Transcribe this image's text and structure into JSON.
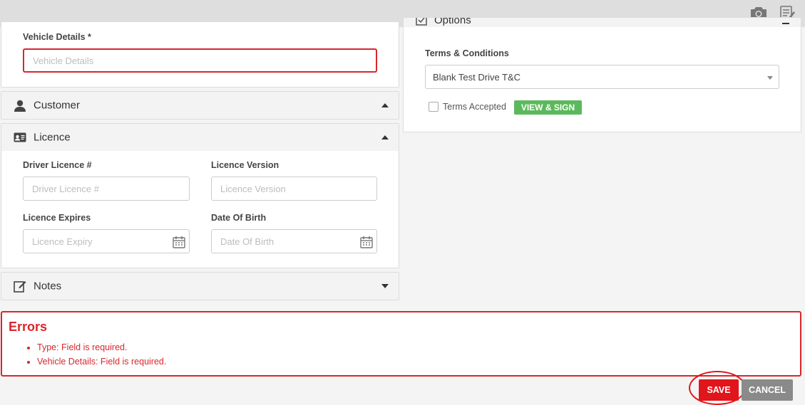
{
  "vehicle": {
    "label": "Vehicle Details *",
    "placeholder": "Vehicle Details"
  },
  "customer": {
    "title": "Customer",
    "icon": "user-icon"
  },
  "licence": {
    "title": "Licence",
    "icon": "id-card-icon",
    "driver_licence_label": "Driver Licence #",
    "driver_licence_placeholder": "Driver Licence #",
    "version_label": "Licence Version",
    "version_placeholder": "Licence Version",
    "expires_label": "Licence Expires",
    "expires_placeholder": "Licence Expiry",
    "dob_label": "Date Of Birth",
    "dob_placeholder": "Date Of Birth"
  },
  "notes": {
    "title": "Notes",
    "icon": "edit-icon"
  },
  "options": {
    "title": "Options",
    "terms_label": "Terms & Conditions",
    "terms_selected": "Blank Test Drive T&C",
    "terms_accepted_label": "Terms Accepted",
    "view_sign_label": "VIEW & SIGN"
  },
  "errors": {
    "title": "Errors",
    "items": [
      "Type: Field is required.",
      "Vehicle Details: Field is required."
    ]
  },
  "actions": {
    "save_label": "SAVE",
    "cancel_label": "CANCEL"
  },
  "colors": {
    "error": "#d9262c",
    "save": "#e0161c",
    "cancel": "#8a8a8a",
    "view_sign": "#5cb85c"
  }
}
